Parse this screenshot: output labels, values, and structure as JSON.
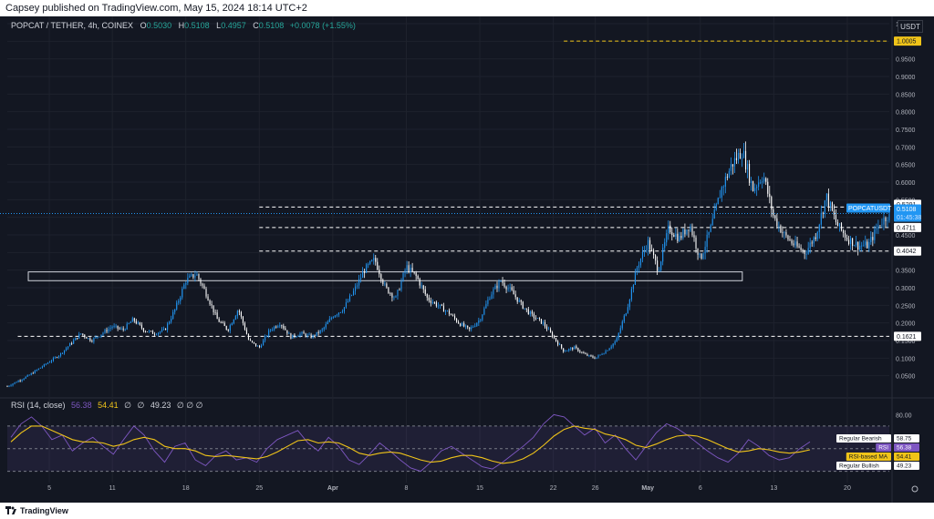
{
  "publish_bar": "Capsey published on TradingView.com, May 15, 2024 18:14 UTC+2",
  "legend": {
    "symbol": "POPCAT / TETHER, 4h, COINEX",
    "o_label": "O",
    "o_val": "0.5030",
    "h_label": "H",
    "h_val": "0.5108",
    "l_label": "L",
    "l_val": "0.4957",
    "c_label": "C",
    "c_val": "0.5108",
    "change": "+0.0078 (+1.55%)"
  },
  "currency": "USDT",
  "rsi_legend": {
    "label": "RSI (14, close)",
    "rsi_val": "56.38",
    "ma_val": "54.41",
    "empty1": "∅",
    "empty2": "∅",
    "band_val": "49.23",
    "empty3": "∅ ∅ ∅"
  },
  "footer": {
    "brand": "TradingView"
  },
  "colors": {
    "bg": "#131722",
    "up": "#2196f3",
    "down": "#ffffff",
    "grid": "#1e222d",
    "axis_text": "#b2b5be",
    "level": "#ffffff",
    "target": "#f0c419",
    "rsi_line": "#7e57c2",
    "rsi_ma": "#f0c419",
    "rsi_band": "#7e57c2"
  },
  "chart_data": [
    {
      "type": "candlestick",
      "title": "POPCAT / TETHER, 4h, COINEX",
      "ylabel": "USDT",
      "ylim": [
        0.0,
        1.05
      ],
      "y_ticks": [
        "0.0500",
        "0.1000",
        "0.1500",
        "0.2000",
        "0.2500",
        "0.3000",
        "0.3500",
        "0.4000",
        "0.4500",
        "0.5000",
        "0.5500",
        "0.6000",
        "0.6500",
        "0.7000",
        "0.7500",
        "0.8000",
        "0.8500",
        "0.9000",
        "0.9500",
        "1.0000",
        "1.0500"
      ],
      "x_ticks": [
        "5",
        "11",
        "18",
        "25",
        "Apr",
        "8",
        "15",
        "22",
        "26",
        "May",
        "6",
        "13",
        "20"
      ],
      "x_dates": [
        "2024-03-05",
        "2024-03-11",
        "2024-03-18",
        "2024-03-25",
        "2024-04-01",
        "2024-04-08",
        "2024-04-15",
        "2024-04-22",
        "2024-04-26",
        "2024-05-01",
        "2024-05-06",
        "2024-05-13",
        "2024-05-20"
      ],
      "x_range": [
        "2024-03-01",
        "2024-05-24"
      ],
      "price_labels": [
        {
          "text": "1.0005",
          "value": 1.0005,
          "style": "target"
        },
        {
          "text": "0.5291",
          "value": 0.5291,
          "style": "level"
        },
        {
          "text": "POPCATUSDT",
          "value": 0.5108,
          "style": "symbol"
        },
        {
          "text": "0.5108",
          "value": 0.5108,
          "style": "current"
        },
        {
          "text": "01:45:38",
          "value": 0.5108,
          "style": "countdown"
        },
        {
          "text": "0.4711",
          "value": 0.4711,
          "style": "level"
        },
        {
          "text": "0.4042",
          "value": 0.4042,
          "style": "level"
        },
        {
          "text": "0.1621",
          "value": 0.1621,
          "style": "level"
        }
      ],
      "horizontal_levels": [
        {
          "value": 1.0005,
          "from": "2024-04-23",
          "to": "2024-05-24",
          "style": "target"
        },
        {
          "value": 0.5291,
          "from": "2024-03-25",
          "to": "2024-05-24",
          "style": "level"
        },
        {
          "value": 0.4711,
          "from": "2024-03-25",
          "to": "2024-05-24",
          "style": "level"
        },
        {
          "value": 0.4042,
          "from": "2024-03-25",
          "to": "2024-05-24",
          "style": "level"
        },
        {
          "value": 0.1621,
          "from": "2024-03-02",
          "to": "2024-05-24",
          "style": "level"
        }
      ],
      "zone": {
        "from": "2024-03-03",
        "to": "2024-05-10",
        "low": 0.32,
        "high": 0.345
      },
      "price_path": [
        [
          "2024-03-01",
          0.02
        ],
        [
          "2024-03-03",
          0.05
        ],
        [
          "2024-03-05",
          0.09
        ],
        [
          "2024-03-06",
          0.11
        ],
        [
          "2024-03-08",
          0.17
        ],
        [
          "2024-03-09",
          0.15
        ],
        [
          "2024-03-11",
          0.19
        ],
        [
          "2024-03-12",
          0.18
        ],
        [
          "2024-03-13",
          0.21
        ],
        [
          "2024-03-14",
          0.18
        ],
        [
          "2024-03-15",
          0.17
        ],
        [
          "2024-03-16",
          0.18
        ],
        [
          "2024-03-17",
          0.24
        ],
        [
          "2024-03-18",
          0.32
        ],
        [
          "2024-03-19",
          0.34
        ],
        [
          "2024-03-20",
          0.28
        ],
        [
          "2024-03-21",
          0.21
        ],
        [
          "2024-03-22",
          0.18
        ],
        [
          "2024-03-23",
          0.24
        ],
        [
          "2024-03-24",
          0.15
        ],
        [
          "2024-03-25",
          0.13
        ],
        [
          "2024-03-26",
          0.18
        ],
        [
          "2024-03-27",
          0.2
        ],
        [
          "2024-03-28",
          0.16
        ],
        [
          "2024-03-29",
          0.17
        ],
        [
          "2024-03-30",
          0.16
        ],
        [
          "2024-03-31",
          0.18
        ],
        [
          "2024-04-01",
          0.22
        ],
        [
          "2024-04-02",
          0.24
        ],
        [
          "2024-04-03",
          0.29
        ],
        [
          "2024-04-04",
          0.35
        ],
        [
          "2024-04-05",
          0.38
        ],
        [
          "2024-04-06",
          0.3
        ],
        [
          "2024-04-07",
          0.27
        ],
        [
          "2024-04-08",
          0.36
        ],
        [
          "2024-04-09",
          0.33
        ],
        [
          "2024-04-10",
          0.27
        ],
        [
          "2024-04-11",
          0.25
        ],
        [
          "2024-04-12",
          0.23
        ],
        [
          "2024-04-13",
          0.2
        ],
        [
          "2024-04-14",
          0.18
        ],
        [
          "2024-04-15",
          0.21
        ],
        [
          "2024-04-16",
          0.28
        ],
        [
          "2024-04-17",
          0.32
        ],
        [
          "2024-04-18",
          0.29
        ],
        [
          "2024-04-19",
          0.25
        ],
        [
          "2024-04-20",
          0.22
        ],
        [
          "2024-04-21",
          0.2
        ],
        [
          "2024-04-22",
          0.16
        ],
        [
          "2024-04-23",
          0.12
        ],
        [
          "2024-04-24",
          0.13
        ],
        [
          "2024-04-25",
          0.11
        ],
        [
          "2024-04-26",
          0.1
        ],
        [
          "2024-04-27",
          0.12
        ],
        [
          "2024-04-28",
          0.15
        ],
        [
          "2024-04-29",
          0.24
        ],
        [
          "2024-04-30",
          0.36
        ],
        [
          "2024-05-01",
          0.43
        ],
        [
          "2024-05-02",
          0.35
        ],
        [
          "2024-05-03",
          0.47
        ],
        [
          "2024-05-04",
          0.44
        ],
        [
          "2024-05-05",
          0.48
        ],
        [
          "2024-05-06",
          0.38
        ],
        [
          "2024-05-07",
          0.47
        ],
        [
          "2024-05-08",
          0.58
        ],
        [
          "2024-05-09",
          0.65
        ],
        [
          "2024-05-10",
          0.69
        ],
        [
          "2024-05-11",
          0.58
        ],
        [
          "2024-05-12",
          0.62
        ],
        [
          "2024-05-13",
          0.5
        ],
        [
          "2024-05-14",
          0.45
        ],
        [
          "2024-05-15",
          0.42
        ],
        [
          "2024-05-16",
          0.4
        ],
        [
          "2024-05-17",
          0.45
        ],
        [
          "2024-05-18",
          0.56
        ],
        [
          "2024-05-19",
          0.48
        ],
        [
          "2024-05-20",
          0.44
        ],
        [
          "2024-05-21",
          0.42
        ],
        [
          "2024-05-22",
          0.42
        ],
        [
          "2024-05-23",
          0.48
        ],
        [
          "2024-05-24",
          0.51
        ]
      ]
    },
    {
      "type": "line",
      "title": "RSI (14, close)",
      "ylim": [
        20,
        90
      ],
      "y_ticks": [
        "80.00"
      ],
      "band_levels": [
        70,
        50,
        30
      ],
      "value_labels": [
        {
          "text": "Regular Bearish",
          "value": 58.75
        },
        {
          "text": "58.75",
          "value": 58.75
        },
        {
          "text": "RSI",
          "value": 56.38
        },
        {
          "text": "56.38",
          "value": 56.38
        },
        {
          "text": "RSI-based MA",
          "value": 54.41
        },
        {
          "text": "54.41",
          "value": 54.41
        },
        {
          "text": "Regular Bullish",
          "value": 49.23
        },
        {
          "text": "49.23",
          "value": 49.23
        }
      ],
      "series": [
        {
          "name": "RSI",
          "color": "#7e57c2",
          "values": [
            60,
            72,
            78,
            70,
            58,
            62,
            48,
            55,
            60,
            52,
            45,
            58,
            70,
            62,
            48,
            38,
            52,
            55,
            40,
            35,
            44,
            48,
            40,
            42,
            38,
            50,
            58,
            62,
            66,
            55,
            48,
            60,
            52,
            40,
            36,
            45,
            55,
            48,
            40,
            33,
            30,
            38,
            48,
            52,
            46,
            40,
            34,
            32,
            38,
            45,
            52,
            60,
            72,
            80,
            78,
            70,
            62,
            68,
            55,
            62,
            50,
            40,
            52,
            64,
            72,
            68,
            62,
            55,
            48,
            42,
            38,
            46,
            58,
            52,
            44,
            40,
            42,
            50,
            56
          ]
        },
        {
          "name": "RSI-based MA",
          "color": "#f0c419",
          "values": [
            56,
            64,
            70,
            70,
            66,
            62,
            58,
            56,
            56,
            55,
            52,
            54,
            58,
            60,
            58,
            52,
            50,
            50,
            48,
            44,
            43,
            44,
            43,
            42,
            41,
            43,
            47,
            52,
            57,
            58,
            55,
            56,
            55,
            51,
            46,
            44,
            46,
            47,
            46,
            43,
            40,
            38,
            39,
            42,
            44,
            44,
            42,
            39,
            37,
            38,
            41,
            46,
            53,
            61,
            67,
            70,
            68,
            67,
            63,
            61,
            58,
            53,
            51,
            54,
            58,
            61,
            62,
            61,
            58,
            54,
            50,
            47,
            48,
            50,
            49,
            47,
            46,
            47,
            49
          ]
        }
      ]
    }
  ]
}
